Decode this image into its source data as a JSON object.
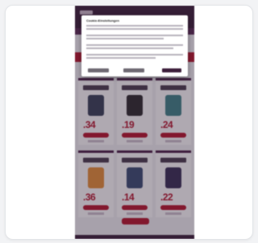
{
  "consent_dialog": {
    "title": "Cookie-Einstellungen"
  },
  "products": [
    {
      "price_text": ".34",
      "phone_color": "#3a3f58"
    },
    {
      "price_text": ".19",
      "phone_color": "#2f2a2f"
    },
    {
      "price_text": ".24",
      "phone_color": "#3f7f86"
    },
    {
      "price_text": ".36",
      "phone_color": "#e08a3a"
    },
    {
      "price_text": ".14",
      "phone_color": "#3b4a72"
    },
    {
      "price_text": ".22",
      "phone_color": "#3a2d55"
    }
  ],
  "colors": {
    "brand_dark": "#3d1f3b",
    "brand_red": "#b3162f"
  }
}
